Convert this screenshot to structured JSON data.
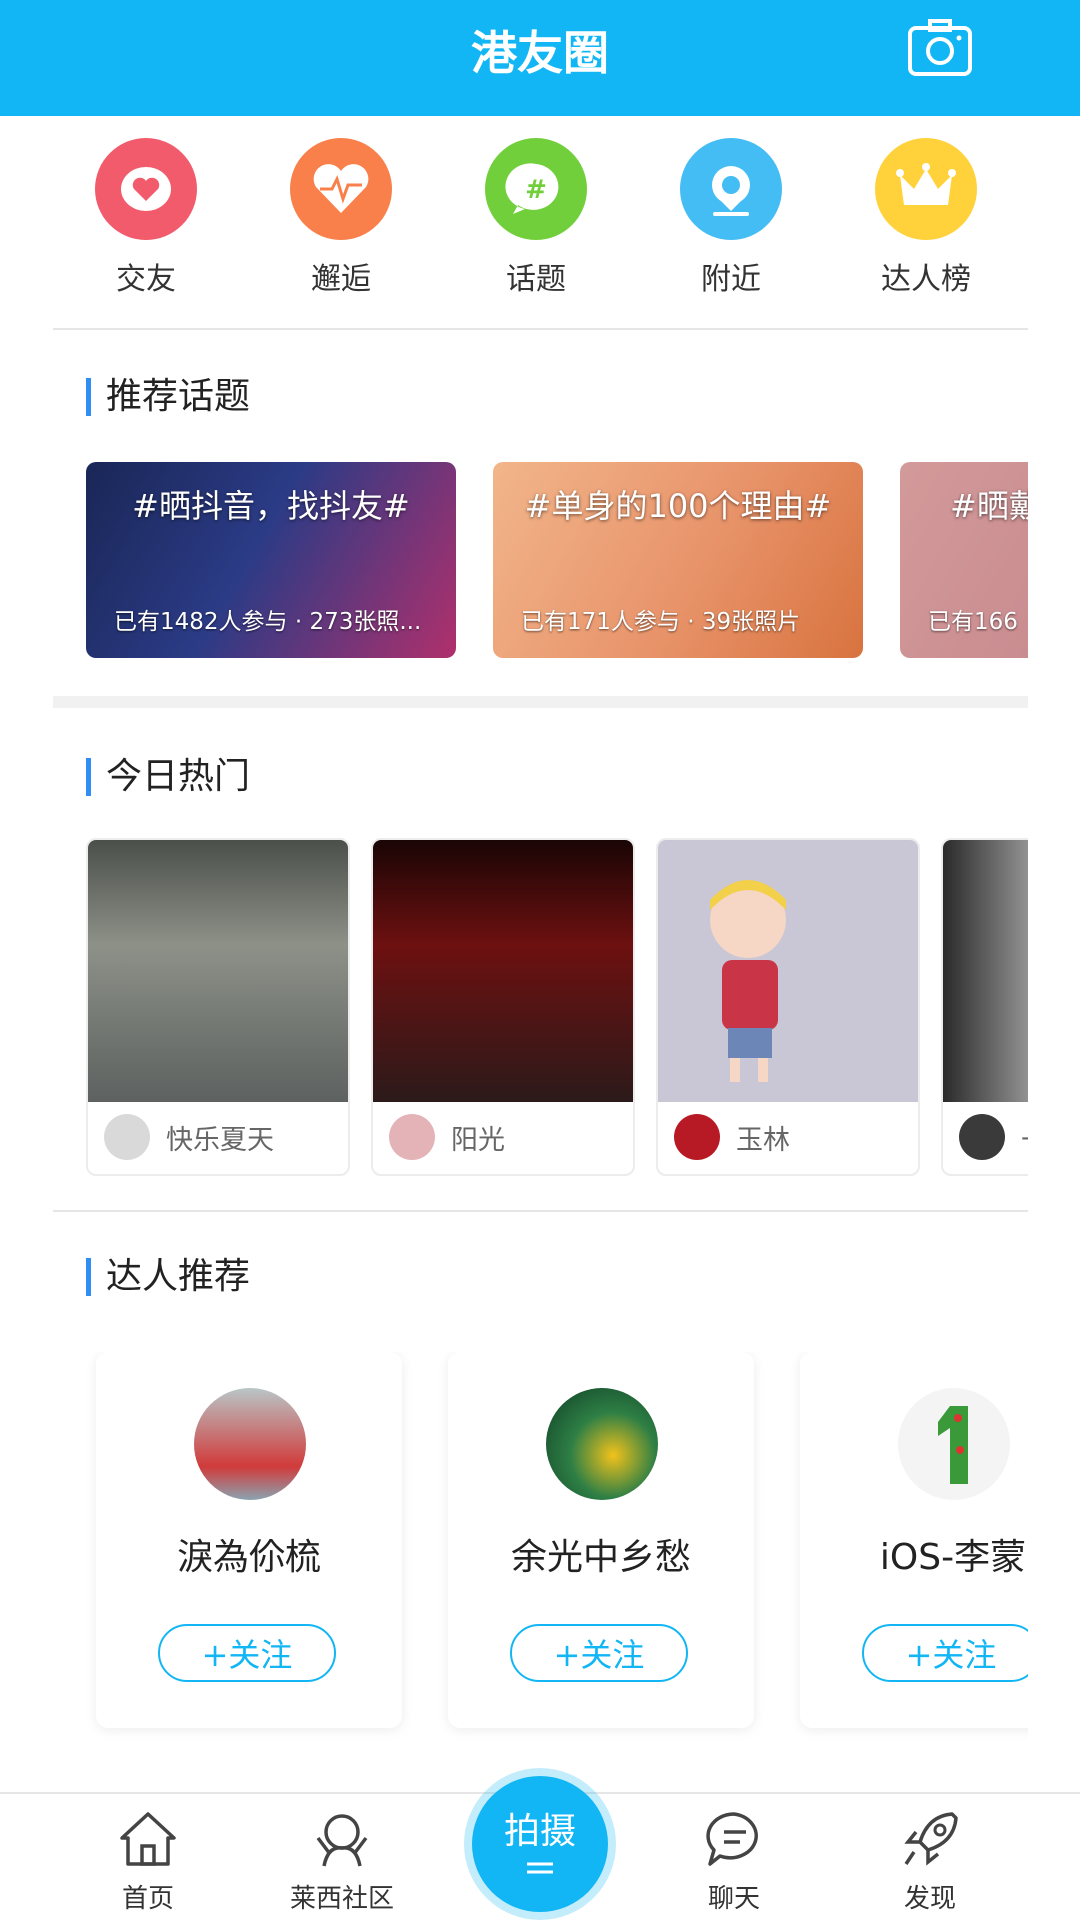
{
  "header": {
    "title": "港友圈",
    "camera_icon": "camera-icon"
  },
  "quick_entries": [
    {
      "label": "交友",
      "icon": "heart-icon",
      "color": "#f25b6b"
    },
    {
      "label": "邂逅",
      "icon": "heartbeat-icon",
      "color": "#f9804a"
    },
    {
      "label": "话题",
      "icon": "hashtag-icon",
      "color": "#72cf3c"
    },
    {
      "label": "附近",
      "icon": "location-icon",
      "color": "#44bdf5"
    },
    {
      "label": "达人榜",
      "icon": "crown-icon",
      "color": "#ffd23c"
    }
  ],
  "recommended_topics": {
    "title": "推荐话题",
    "items": [
      {
        "name": "#晒抖音，找抖友#",
        "stats": "已有1482人参与 · 273张照..."
      },
      {
        "name": "#单身的100个理由#",
        "stats": "已有171人参与 · 39张照片"
      },
      {
        "name": "#晒戴",
        "stats": "已有166"
      }
    ]
  },
  "hot_today": {
    "title": "今日热门",
    "items": [
      {
        "user": "快乐夏天"
      },
      {
        "user": "阳光"
      },
      {
        "user": "玉林"
      },
      {
        "user": "-"
      }
    ]
  },
  "experts": {
    "title": "达人推荐",
    "items": [
      {
        "name": "淚為伱梳",
        "follow_label": "+关注"
      },
      {
        "name": "余光中乡愁",
        "follow_label": "+关注"
      },
      {
        "name": "iOS-李蒙",
        "follow_label": "+关注"
      }
    ]
  },
  "tabbar": {
    "items": [
      {
        "label": "首页",
        "icon": "home-icon"
      },
      {
        "label": "莱西社区",
        "icon": "community-icon"
      },
      {
        "label": "拍摄",
        "icon": "shoot-icon"
      },
      {
        "label": "聊天",
        "icon": "chat-icon"
      },
      {
        "label": "发现",
        "icon": "rocket-icon"
      }
    ]
  },
  "colors": {
    "primary": "#13b6f4",
    "section_bar": "#2f8df3"
  }
}
